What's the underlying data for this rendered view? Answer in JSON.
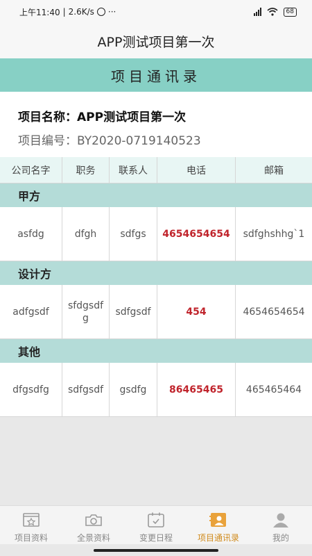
{
  "status": {
    "time": "上午11:40",
    "speed": "2.6K/s",
    "dots": "···",
    "battery": "68"
  },
  "appbar": {
    "title": "APP测试项目第一次"
  },
  "section": {
    "title": "项目通讯录"
  },
  "info": {
    "name": "项目名称：APP测试项目第一次",
    "code": "项目编号：BY2020-0719140523"
  },
  "table": {
    "headers": [
      "公司名字",
      "职务",
      "联系人",
      "电话",
      "邮箱"
    ],
    "groups": [
      {
        "title": "甲方",
        "rows": [
          [
            "asfdg",
            "dfgh",
            "sdfgs",
            "4654654654",
            "sdfghshhg`1"
          ]
        ]
      },
      {
        "title": "设计方",
        "rows": [
          [
            "adfgsdf",
            "sfdgsdfg",
            "sdfgsdf",
            "454",
            "4654654654"
          ]
        ]
      },
      {
        "title": "其他",
        "rows": [
          [
            "dfgsdfg",
            "sdfgsdf",
            "gsdfg",
            "86465465",
            "465465464"
          ]
        ]
      }
    ]
  },
  "tabs": [
    {
      "label": "项目资料",
      "icon": "star-folder-icon",
      "active": false
    },
    {
      "label": "全景资料",
      "icon": "camera-icon",
      "active": false
    },
    {
      "label": "变更日程",
      "icon": "calendar-icon",
      "active": false
    },
    {
      "label": "项目通讯录",
      "icon": "contact-card-icon",
      "active": true
    },
    {
      "label": "我的",
      "icon": "user-icon",
      "active": false
    }
  ],
  "colors": {
    "accent": "#87d0c5",
    "group_bg": "#b4dcd8",
    "phone": "#c0242c",
    "active_tab": "#d08a1b"
  }
}
